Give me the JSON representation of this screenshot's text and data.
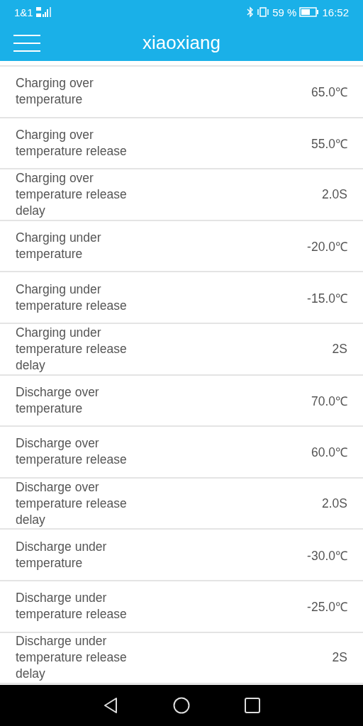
{
  "status_bar": {
    "carrier": "1&1",
    "battery": "59 %",
    "time": "16:52"
  },
  "app_bar": {
    "title": "xiaoxiang"
  },
  "rows": [
    {
      "label": "Charging over temperature",
      "value": "65.0℃"
    },
    {
      "label": "Charging over temperature release",
      "value": "55.0℃"
    },
    {
      "label": "Charging over temperature release delay",
      "value": "2.0S"
    },
    {
      "label": "Charging under temperature",
      "value": "-20.0℃"
    },
    {
      "label": "Charging under temperature release",
      "value": "-15.0℃"
    },
    {
      "label": "Charging under temperature release delay",
      "value": "2S"
    },
    {
      "label": "Discharge over temperature",
      "value": "70.0℃"
    },
    {
      "label": "Discharge over temperature release",
      "value": "60.0℃"
    },
    {
      "label": "Discharge over temperature release delay",
      "value": "2.0S"
    },
    {
      "label": "Discharge under temperature",
      "value": "-30.0℃"
    },
    {
      "label": "Discharge under temperature release",
      "value": "-25.0℃"
    },
    {
      "label": "Discharge under temperature release delay",
      "value": "2S"
    }
  ]
}
